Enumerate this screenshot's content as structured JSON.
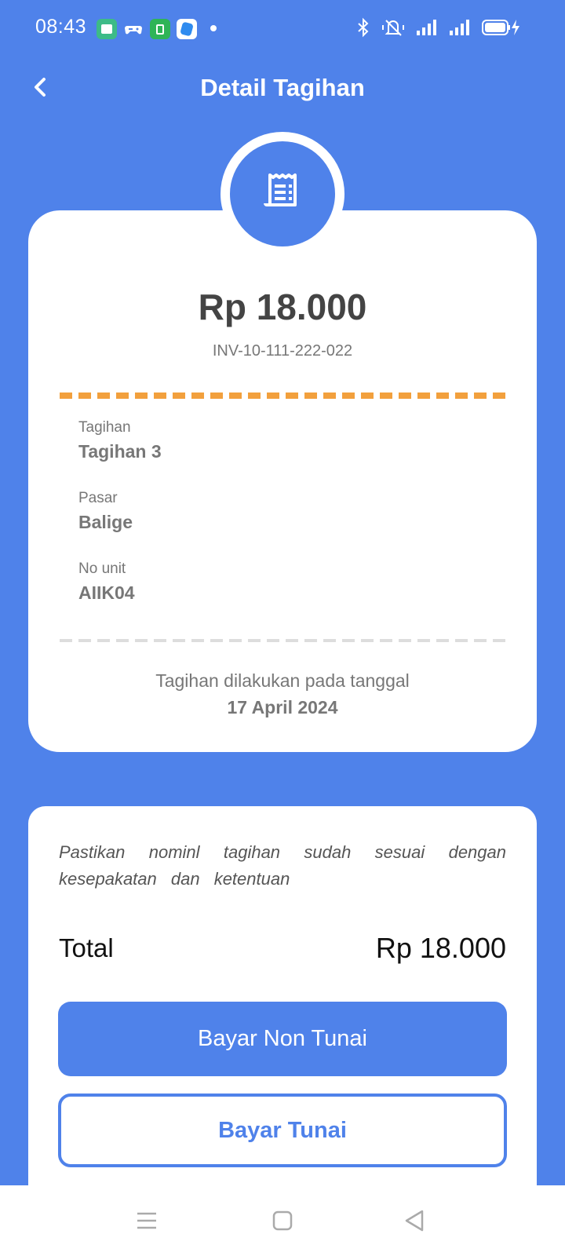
{
  "status_bar": {
    "time": "08:43",
    "app_icons": [
      {
        "name": "chat-app-icon",
        "color": "#3DBB87"
      },
      {
        "name": "game-controller-icon",
        "color": "#FFFFFF"
      },
      {
        "name": "store-app-icon",
        "color": "#2FB457"
      },
      {
        "name": "blue-app-icon",
        "color": "#FFFFFF"
      }
    ],
    "system_icons": [
      "bluetooth-icon",
      "mute-icon",
      "signal-icon",
      "signal-icon",
      "battery-charging-icon"
    ]
  },
  "header": {
    "title": "Detail Tagihan",
    "back_icon": "chevron-left-icon"
  },
  "detail": {
    "receipt_icon": "receipt-icon",
    "amount": "Rp 18.000",
    "invoice": "INV-10-111-222-022",
    "fields": [
      {
        "label": "Tagihan",
        "value": "Tagihan 3"
      },
      {
        "label": "Pasar",
        "value": "Balige"
      },
      {
        "label": "No unit",
        "value": "AIIK04"
      }
    ],
    "date_note": "Tagihan dilakukan pada tanggal",
    "date_value": "17 April 2024"
  },
  "payment": {
    "notice": "Pastikan nominl tagihan sudah sesuai dengan kesepakatan dan ketentuan",
    "total_label": "Total",
    "total_value": "Rp 18.000",
    "primary_button": "Bayar Non Tunai",
    "secondary_button": "Bayar Tunai"
  },
  "nav_bar": {
    "items": [
      "menu-icon",
      "home-square-icon",
      "back-triangle-icon"
    ]
  },
  "colors": {
    "primary": "#4F82EA",
    "accent_dash": "#F2A03D",
    "text_grey": "#777777"
  }
}
